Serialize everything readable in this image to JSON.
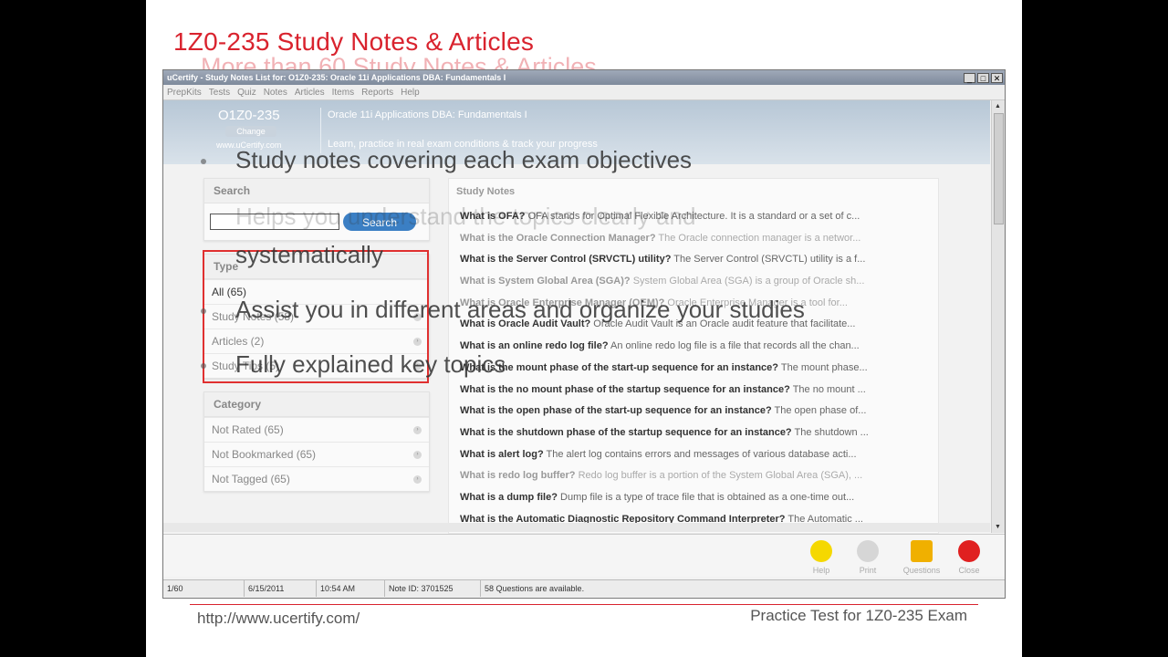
{
  "slide": {
    "title": "1Z0-235 Study Notes & Articles",
    "ghost_subtitle": "More than 60 Study Notes & Articles",
    "footer_url": "http://www.ucertify.com/",
    "footer_right": "Practice Test for 1Z0-235 Exam",
    "accent_color": "#d9232e"
  },
  "overlay_bullets": [
    "Study notes covering each exam objectives",
    "Helps you understand the topics clearly and",
    "systematically",
    "Assist you in different areas and organize your studies",
    "Fully explained key topics"
  ],
  "app": {
    "window_title": "uCertify - Study Notes List for: O1Z0-235: Oracle 11i Applications DBA: Fundamentals I",
    "menu": [
      "PrepKits",
      "Tests",
      "Quiz",
      "Notes",
      "Articles",
      "Items",
      "Reports",
      "Help"
    ],
    "banner": {
      "exam_code": "O1Z0-235",
      "change_label": "Change",
      "site": "www.uCertify.com",
      "exam_name": "Oracle 11i Applications DBA: Fundamentals I",
      "tagline": "Learn, practice in real exam conditions & track your progress"
    },
    "search": {
      "header": "Search",
      "button": "Search",
      "value": ""
    },
    "type": {
      "header": "Type",
      "items": [
        "All (65)",
        "Study Notes (58)",
        "Articles (2)",
        "Study Tips (5)"
      ]
    },
    "category": {
      "header": "Category",
      "items": [
        "Not Rated (65)",
        "Not Bookmarked (65)",
        "Not Tagged (65)"
      ]
    },
    "notes": {
      "header": "Study Notes",
      "items": [
        {
          "q": "What is OFA?",
          "a": "OFA stands for Optimal Flexible Architecture. It is a standard or a set of c..."
        },
        {
          "q": "What is the Oracle Connection Manager?",
          "a": "The Oracle connection manager is a networ..."
        },
        {
          "q": "What is the Server Control (SRVCTL) utility?",
          "a": "The Server Control (SRVCTL) utility is a f..."
        },
        {
          "q": "What is System Global Area (SGA)?",
          "a": "System Global Area (SGA) is a group of Oracle sh..."
        },
        {
          "q": "What is Oracle Enterprise Manager (OEM)?",
          "a": "Oracle Enterprise Manager is a tool for..."
        },
        {
          "q": "What is Oracle Audit Vault?",
          "a": "Oracle Audit Vault is an Oracle audit feature that facilitate..."
        },
        {
          "q": "What is an online redo log file?",
          "a": "An online redo log file is a file that records all the chan..."
        },
        {
          "q": "What is the mount phase of the start-up sequence for an instance?",
          "a": "The mount phase..."
        },
        {
          "q": "What is the no mount phase of the startup sequence for an instance?",
          "a": "The no mount ..."
        },
        {
          "q": "What is the open phase of the start-up sequence for an instance?",
          "a": "The open phase of..."
        },
        {
          "q": "What is the shutdown phase of the startup sequence for an instance?",
          "a": "The shutdown ..."
        },
        {
          "q": "What is alert log?",
          "a": "The alert log contains errors and messages of various database acti..."
        },
        {
          "q": "What is redo log buffer?",
          "a": "Redo log buffer is a portion of the System Global Area (SGA), ..."
        },
        {
          "q": "What is a dump file?",
          "a": "Dump file is a type of trace file that is obtained as a one-time out..."
        },
        {
          "q": "What is the Automatic Diagnostic Repository Command Interpreter?",
          "a": "The Automatic ..."
        }
      ]
    },
    "toolbar": {
      "help": "Help",
      "print": "Print",
      "questions": "Questions",
      "close": "Close"
    },
    "status": {
      "page": "1/60",
      "date": "6/15/2011",
      "time": "10:54 AM",
      "note_id": "Note ID: 3701525",
      "questions": "58 Questions are available."
    }
  }
}
